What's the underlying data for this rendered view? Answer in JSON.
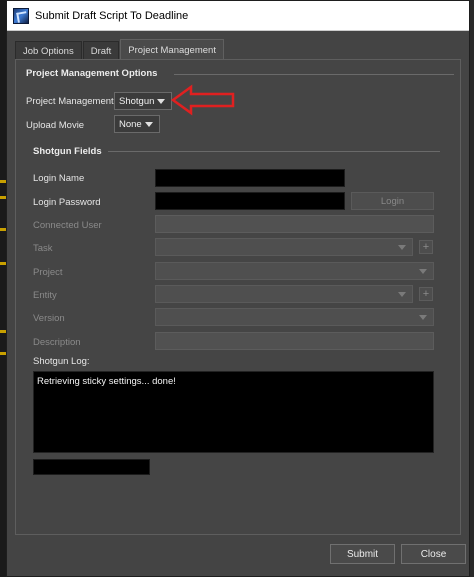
{
  "window": {
    "title": "Submit Draft Script To Deadline",
    "icon": "deadline-app-icon"
  },
  "tabs": [
    {
      "label": "Job Options",
      "active": false
    },
    {
      "label": "Draft",
      "active": false
    },
    {
      "label": "Project Management",
      "active": true
    }
  ],
  "project_management": {
    "section_title": "Project Management Options",
    "pm_label": "Project Management",
    "pm_value": "Shotgun",
    "upload_label": "Upload Movie",
    "upload_value": "None"
  },
  "shotgun": {
    "section_title": "Shotgun Fields",
    "login_name_label": "Login Name",
    "login_password_label": "Login Password",
    "login_button": "Login",
    "connected_user_label": "Connected User",
    "task_label": "Task",
    "project_label": "Project",
    "entity_label": "Entity",
    "version_label": "Version",
    "description_label": "Description",
    "plus": "+",
    "log_label": "Shotgun Log:",
    "log_text": "Retrieving sticky settings... done!"
  },
  "footer": {
    "submit": "Submit",
    "close": "Close"
  },
  "colors": {
    "annotation_arrow": "#e02020",
    "window_bg": "#444444",
    "input_bg": "#000000"
  }
}
